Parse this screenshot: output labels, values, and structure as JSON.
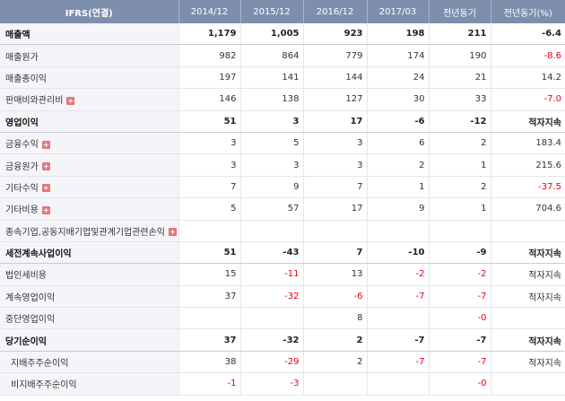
{
  "headers": [
    "IFRS(연결)",
    "2014/12",
    "2015/12",
    "2016/12",
    "2017/03",
    "전년동기",
    "전년동기(%)"
  ],
  "rows": [
    {
      "label": "매출액",
      "bold": true,
      "expand": false,
      "sub": false,
      "values": [
        "1,179",
        "1,005",
        "923",
        "198",
        "211",
        "-6.4"
      ]
    },
    {
      "label": "매출원가",
      "bold": false,
      "expand": false,
      "sub": false,
      "values": [
        "982",
        "864",
        "779",
        "174",
        "190",
        "-8.6"
      ]
    },
    {
      "label": "매출총이익",
      "bold": false,
      "expand": false,
      "sub": false,
      "values": [
        "197",
        "141",
        "144",
        "24",
        "21",
        "14.2"
      ]
    },
    {
      "label": "판매비와관리비",
      "bold": false,
      "expand": true,
      "sub": false,
      "values": [
        "146",
        "138",
        "127",
        "30",
        "33",
        "-7.0"
      ]
    },
    {
      "label": "영업이익",
      "bold": true,
      "expand": false,
      "sub": false,
      "values": [
        "51",
        "3",
        "17",
        "-6",
        "-12",
        "적자지속"
      ]
    },
    {
      "label": "금융수익",
      "bold": false,
      "expand": true,
      "sub": false,
      "values": [
        "3",
        "5",
        "3",
        "6",
        "2",
        "183.4"
      ]
    },
    {
      "label": "금융원가",
      "bold": false,
      "expand": true,
      "sub": false,
      "values": [
        "3",
        "3",
        "3",
        "2",
        "1",
        "215.6"
      ]
    },
    {
      "label": "기타수익",
      "bold": false,
      "expand": true,
      "sub": false,
      "values": [
        "7",
        "9",
        "7",
        "1",
        "2",
        "-37.5"
      ]
    },
    {
      "label": "기타비용",
      "bold": false,
      "expand": true,
      "sub": false,
      "values": [
        "5",
        "57",
        "17",
        "9",
        "1",
        "704.6"
      ]
    },
    {
      "label": "종속기업,공동지배기업및관계기업관련손익",
      "bold": false,
      "expand": true,
      "sub": false,
      "values": [
        "",
        "",
        "",
        "",
        "",
        ""
      ]
    },
    {
      "label": "세전계속사업이익",
      "bold": true,
      "expand": false,
      "sub": false,
      "values": [
        "51",
        "-43",
        "7",
        "-10",
        "-9",
        "적자지속"
      ]
    },
    {
      "label": "법인세비용",
      "bold": false,
      "expand": false,
      "sub": false,
      "values": [
        "15",
        "-11",
        "13",
        "-2",
        "-2",
        "적자지속"
      ]
    },
    {
      "label": "계속영업이익",
      "bold": false,
      "expand": false,
      "sub": false,
      "values": [
        "37",
        "-32",
        "-6",
        "-7",
        "-7",
        "적자지속"
      ]
    },
    {
      "label": "중단영업이익",
      "bold": false,
      "expand": false,
      "sub": false,
      "values": [
        "",
        "",
        "8",
        "",
        "-0",
        ""
      ]
    },
    {
      "label": "당기순이익",
      "bold": true,
      "expand": false,
      "sub": false,
      "values": [
        "37",
        "-32",
        "2",
        "-7",
        "-7",
        "적자지속"
      ]
    },
    {
      "label": "지배주주순이익",
      "bold": false,
      "expand": false,
      "sub": true,
      "values": [
        "38",
        "-29",
        "2",
        "-7",
        "-7",
        "적자지속"
      ]
    },
    {
      "label": "비지배주주순이익",
      "bold": false,
      "expand": false,
      "sub": true,
      "values": [
        "-1",
        "-3",
        "",
        "",
        "-0",
        ""
      ]
    }
  ],
  "colors": {
    "header_bg": "#7e8fae",
    "negative": "#e60012",
    "label_bg": "#f4f5f8",
    "expand_icon": "#e8747b"
  },
  "expand_icon_name": "plus-icon"
}
